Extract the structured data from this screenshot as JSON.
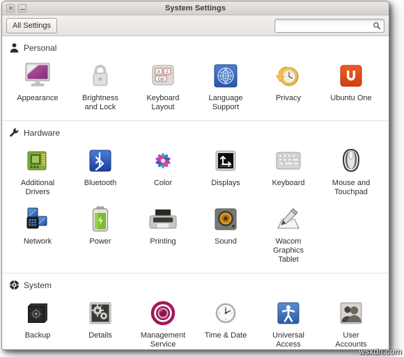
{
  "window": {
    "title": "System Settings",
    "close_label": "Close",
    "minimize_label": "Minimize"
  },
  "toolbar": {
    "all_settings_label": "All Settings",
    "search_value": "",
    "search_placeholder": ""
  },
  "sections": [
    {
      "id": "personal",
      "title": "Personal",
      "icon": "person-icon",
      "items": [
        {
          "label": "Appearance",
          "icon": "appearance-icon"
        },
        {
          "label": "Brightness\nand Lock",
          "icon": "brightness-lock-icon"
        },
        {
          "label": "Keyboard\nLayout",
          "icon": "keyboard-layout-icon"
        },
        {
          "label": "Language\nSupport",
          "icon": "language-support-icon"
        },
        {
          "label": "Privacy",
          "icon": "privacy-icon"
        },
        {
          "label": "Ubuntu One",
          "icon": "ubuntu-one-icon"
        }
      ]
    },
    {
      "id": "hardware",
      "title": "Hardware",
      "icon": "wrench-icon",
      "items": [
        {
          "label": "Additional\nDrivers",
          "icon": "additional-drivers-icon"
        },
        {
          "label": "Bluetooth",
          "icon": "bluetooth-icon"
        },
        {
          "label": "Color",
          "icon": "color-icon"
        },
        {
          "label": "Displays",
          "icon": "displays-icon"
        },
        {
          "label": "Keyboard",
          "icon": "keyboard-icon"
        },
        {
          "label": "Mouse and\nTouchpad",
          "icon": "mouse-touchpad-icon"
        },
        {
          "label": "Network",
          "icon": "network-icon"
        },
        {
          "label": "Power",
          "icon": "power-icon"
        },
        {
          "label": "Printing",
          "icon": "printing-icon"
        },
        {
          "label": "Sound",
          "icon": "sound-icon"
        },
        {
          "label": "Wacom\nGraphics\nTablet",
          "icon": "wacom-tablet-icon"
        }
      ]
    },
    {
      "id": "system",
      "title": "System",
      "icon": "system-gear-icon",
      "items": [
        {
          "label": "Backup",
          "icon": "backup-icon"
        },
        {
          "label": "Details",
          "icon": "details-icon"
        },
        {
          "label": "Management\nService",
          "icon": "management-service-icon"
        },
        {
          "label": "Time & Date",
          "icon": "time-date-icon"
        },
        {
          "label": "Universal\nAccess",
          "icon": "universal-access-icon"
        },
        {
          "label": "User\nAccounts",
          "icon": "user-accounts-icon"
        }
      ]
    }
  ],
  "watermark": {
    "text": "wsxdn.com"
  },
  "colors": {
    "window_bg": "#f6f5f4",
    "content_bg": "#ffffff",
    "titlebar_text": "#3b3a38",
    "ubuntu_orange": "#dd4814",
    "bluetooth_blue": "#2a63c4",
    "power_green": "#76b82a",
    "management_magenta": "#a3195b",
    "access_blue": "#3465a4"
  }
}
